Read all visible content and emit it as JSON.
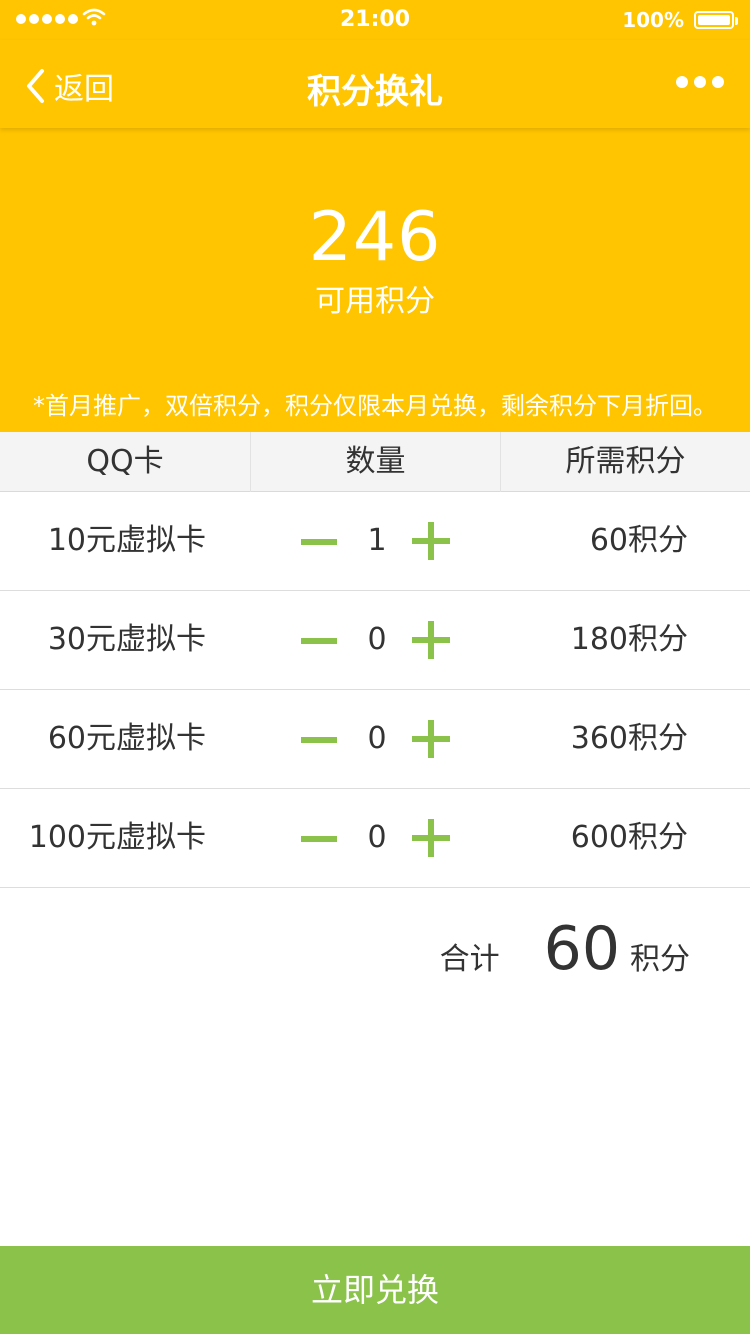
{
  "status_bar": {
    "time": "21:00",
    "battery_text": "100%"
  },
  "nav": {
    "back_label": "返回",
    "title": "积分换礼"
  },
  "points": {
    "value": "246",
    "label": "可用积分"
  },
  "notice": "*首月推广，双倍积分，积分仅限本月兑换，剩余积分下月折回。",
  "table": {
    "headers": [
      "QQ卡",
      "数量",
      "所需积分"
    ],
    "rows": [
      {
        "name": "10元虚拟卡",
        "qty": "1",
        "cost": "60积分"
      },
      {
        "name": "30元虚拟卡",
        "qty": "0",
        "cost": "180积分"
      },
      {
        "name": "60元虚拟卡",
        "qty": "0",
        "cost": "360积分"
      },
      {
        "name": "100元虚拟卡",
        "qty": "0",
        "cost": "600积分"
      }
    ]
  },
  "total": {
    "label": "合计",
    "value": "60",
    "unit": "积分"
  },
  "cta": {
    "label": "立即兑换"
  },
  "colors": {
    "header_bg": "#FFC500",
    "accent_green": "#8BC34A",
    "table_header_bg": "#F4F4F4"
  }
}
